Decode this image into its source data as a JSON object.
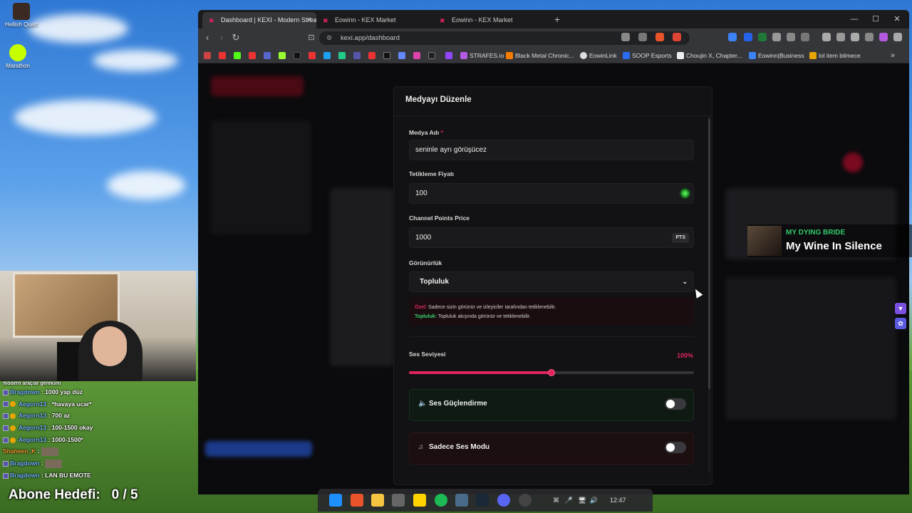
{
  "desktop": {
    "icons": [
      {
        "label": "Hellish Quart"
      },
      {
        "label": "Marathon"
      }
    ]
  },
  "browser": {
    "tabs": [
      {
        "label": "Dashboard | KEXI - Modern Strea",
        "active": true
      },
      {
        "label": "Eowinn - KEX Market",
        "active": false
      },
      {
        "label": "Eowinn - KEX Market",
        "active": false
      }
    ],
    "url": "kexi.app/dashboard",
    "bookmarks": [
      {
        "label": "STRAFES.io"
      },
      {
        "label": "Black Metal Chronic..."
      },
      {
        "label": "EowinLink"
      },
      {
        "label": "SOOP Esports"
      },
      {
        "label": "Choujin X, Chapter..."
      },
      {
        "label": "Eowinn|Business"
      },
      {
        "label": "lol item bilmece"
      }
    ]
  },
  "modal": {
    "title": "Medyayı Düzenle",
    "media_name_label": "Medya Adı",
    "media_name_required": "*",
    "media_name_value": "seninle ayrı görüşücez",
    "trigger_price_label": "Tetikleme Fiyatı",
    "trigger_price_value": "100",
    "channel_points_label": "Channel Points Price",
    "channel_points_value": "1000",
    "channel_points_unit": "PTS",
    "visibility_label": "Görünürlük",
    "visibility_value": "Topluluk",
    "info_private_key": "Özel:",
    "info_private_text": "Sadece sizin görünür ve izleyiciler tarafından tetiklenebilir.",
    "info_community_key": "Topluluk:",
    "info_community_text": "Topluluk akışında görünür ve tetiklenebilir.",
    "volume_label": "Ses Seviyesi",
    "volume_value": "100%",
    "volume_fraction": 0.5,
    "boost_label": "Ses Güçlendirme",
    "boost_on": false,
    "audio_only_label": "Sadece Ses Modu",
    "audio_only_on": false
  },
  "now_playing": {
    "artist": "MY DYING BRIDE",
    "song": "My Wine In Silence"
  },
  "chat": {
    "lines": [
      {
        "user": "Bragdown",
        "text": ": 1000 yap düz",
        "color": "blue"
      },
      {
        "user": "Aegorn13",
        "text": ": *havaya ucar*",
        "color": "blue"
      },
      {
        "user": "Aegorn13",
        "text": ": 700 az",
        "color": "blue"
      },
      {
        "user": "Aegorn13",
        "text": ": 100-1500 okay",
        "color": "blue"
      },
      {
        "user": "Aegorn13",
        "text": ": 1000-1500*",
        "color": "blue"
      },
      {
        "user": "Shaheen_K",
        "text": ":",
        "color": "orange"
      },
      {
        "user": "Bragdown",
        "text": ":",
        "color": "blue"
      },
      {
        "user": "Bragdown",
        "text": ": LAN BU EMOTE",
        "color": "blue"
      }
    ],
    "top_partial": "modern araçlar gerekiini"
  },
  "sub_goal": {
    "label": "Abone Hedefi:",
    "value": "0 / 5"
  },
  "taskbar": {
    "time": "12:47"
  }
}
